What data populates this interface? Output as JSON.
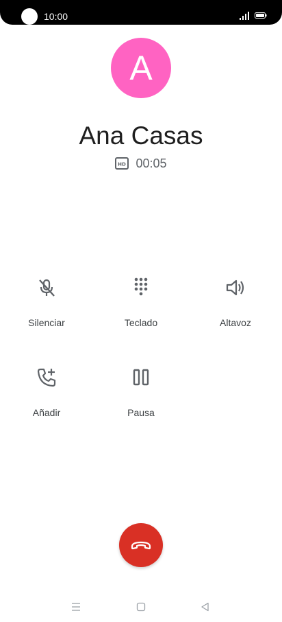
{
  "status_bar": {
    "time": "10:00"
  },
  "contact": {
    "initial": "A",
    "name": "Ana Casas",
    "avatar_color": "#ff63c2"
  },
  "call": {
    "quality_icon": "hd-icon",
    "duration": "00:05"
  },
  "actions": [
    {
      "label": "Silenciar",
      "icon": "mic-off-icon"
    },
    {
      "label": "Teclado",
      "icon": "dialpad-icon"
    },
    {
      "label": "Altavoz",
      "icon": "speaker-icon"
    },
    {
      "label": "Añadir",
      "icon": "add-call-icon"
    },
    {
      "label": "Pausa",
      "icon": "pause-icon"
    }
  ],
  "end_call": {
    "icon": "hang-up-icon",
    "color": "#d93025"
  },
  "nav_bar": {
    "icons": [
      "menu-icon",
      "home-icon",
      "back-icon"
    ]
  },
  "colors": {
    "icon_gray": "#5f6368",
    "text_dark": "#1f1f1f"
  }
}
